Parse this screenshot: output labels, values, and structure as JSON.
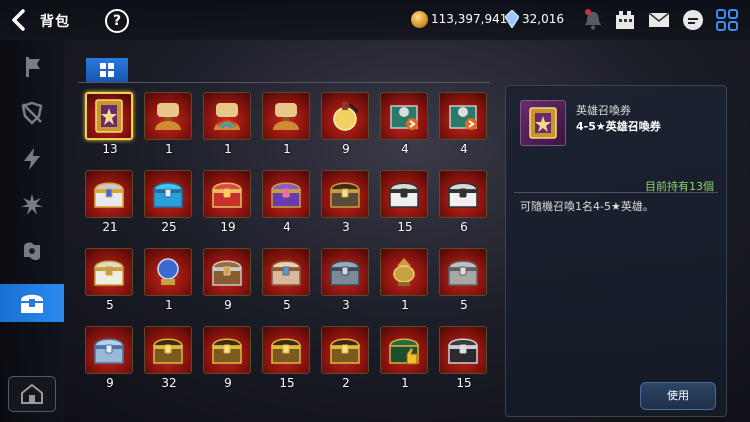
{
  "header": {
    "title": "背包",
    "help_label": "?",
    "gold": "113,397,941",
    "gems": "32,016"
  },
  "sidebar": {
    "items": [
      {
        "icon": "sword-banner-icon"
      },
      {
        "icon": "shield-icon"
      },
      {
        "icon": "lightning-icon"
      },
      {
        "icon": "burst-icon"
      },
      {
        "icon": "rune-icon"
      },
      {
        "icon": "chest-icon",
        "active": true
      }
    ],
    "bottom_icon": "building-icon"
  },
  "inventory": {
    "rows": [
      [
        {
          "item": "hero-summon-ticket",
          "qty": "13",
          "selected": true
        },
        {
          "item": "scroll-bag",
          "qty": "1"
        },
        {
          "item": "rainbow-scroll-bag",
          "qty": "1"
        },
        {
          "item": "scroll-bag",
          "qty": "1"
        },
        {
          "item": "potion",
          "qty": "9"
        },
        {
          "item": "green-arrow-chest",
          "qty": "4"
        },
        {
          "item": "green-arrow-chest",
          "qty": "4"
        }
      ],
      [
        {
          "item": "silver-gold-chest",
          "qty": "21"
        },
        {
          "item": "blue-chest",
          "qty": "25"
        },
        {
          "item": "red-chest",
          "qty": "19"
        },
        {
          "item": "purple-chest",
          "qty": "4"
        },
        {
          "item": "open-dark-chest",
          "qty": "3"
        },
        {
          "item": "white-rune-chest",
          "qty": "15"
        },
        {
          "item": "white-rune-chest",
          "qty": "6"
        }
      ],
      [
        {
          "item": "white-gold-chest",
          "qty": "5"
        },
        {
          "item": "crystal-globe",
          "qty": "1"
        },
        {
          "item": "wood-chest",
          "qty": "9"
        },
        {
          "item": "ornate-chest",
          "qty": "5"
        },
        {
          "item": "steel-chest",
          "qty": "3"
        },
        {
          "item": "lantern",
          "qty": "1"
        },
        {
          "item": "grey-chest",
          "qty": "5"
        }
      ],
      [
        {
          "item": "blue-steel-chest",
          "qty": "9"
        },
        {
          "item": "gold-chest",
          "qty": "32"
        },
        {
          "item": "gold-chest",
          "qty": "9"
        },
        {
          "item": "gold-chest",
          "qty": "15"
        },
        {
          "item": "gold-chest",
          "qty": "2"
        },
        {
          "item": "green-hand-chest",
          "qty": "1"
        },
        {
          "item": "black-chest",
          "qty": "15"
        }
      ]
    ]
  },
  "detail": {
    "name": "英雄召喚券",
    "subtitle": "4-5★英雄召喚券",
    "owned": "目前持有13個",
    "description": "可隨機召喚1名4-5★英雄。",
    "use_label": "使用"
  },
  "colors": {
    "accent_blue": "#2a8af0",
    "slot_red": "#c22a1e",
    "selected_gold": "#f2d24a",
    "owned_green": "#8fd36a"
  }
}
